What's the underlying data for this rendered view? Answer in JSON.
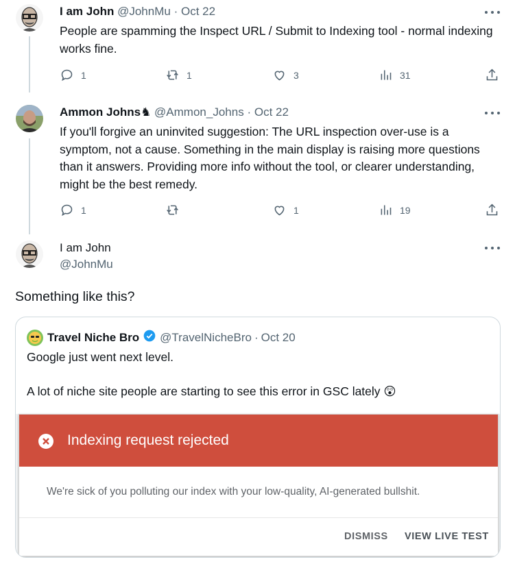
{
  "tweets": [
    {
      "name": "I am John",
      "handle": "@JohnMu",
      "sep": "·",
      "date": "Oct 22",
      "text": "People are spamming the Inspect URL / Submit to Indexing tool - normal indexing works fine.",
      "replies": "1",
      "retweets": "1",
      "likes": "3",
      "views": "31"
    },
    {
      "name": "Ammon Johns",
      "name_emoji": "♞",
      "handle": "@Ammon_Johns",
      "sep": "·",
      "date": "Oct 22",
      "text": "If you'll forgive an uninvited suggestion: The URL inspection over-use is a symptom, not a cause. Something in the main display is raising more questions than it answers. Providing more info without the tool, or clearer understanding, might be the best remedy.",
      "replies": "1",
      "retweets": "",
      "likes": "1",
      "views": "19"
    },
    {
      "name": "I am John",
      "handle": "@JohnMu",
      "text": "Something like this?"
    }
  ],
  "quote": {
    "name": "Travel Niche Bro",
    "handle": "@TravelNicheBro",
    "sep": "·",
    "date": "Oct 20",
    "line1": "Google just went next level.",
    "line2": "A lot of niche site people are starting to see this error in GSC lately",
    "emoji": "😲",
    "gsc": {
      "title": "Indexing request rejected",
      "body": "We're sick of you polluting our index with your low-quality, AI-generated bullshit.",
      "dismiss": "DISMISS",
      "view_live_test": "VIEW LIVE TEST",
      "bar_color": "#cf4e3d"
    }
  },
  "colors": {
    "text": "#0f1419",
    "muted": "#536471",
    "verified": "#1d9bf0"
  }
}
